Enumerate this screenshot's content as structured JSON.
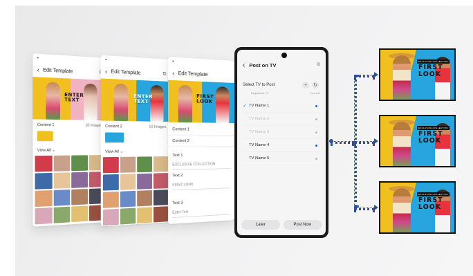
{
  "colors": {
    "accent": "#1c64d6",
    "connector": "#2c4fa0",
    "yellow": "#f2c01e",
    "blue": "#27a5de"
  },
  "screen1": {
    "header": {
      "title": "Edit Template"
    },
    "hero": {
      "text": "ENTER TEXT"
    },
    "content_row": {
      "label": "Content 1",
      "value": "10 Images"
    },
    "view_all": "View All ⌄"
  },
  "screen2": {
    "header": {
      "title": "Edit Template"
    },
    "hero": {
      "text": "ENTER TEXT"
    },
    "content_row": {
      "label": "Content 2",
      "value": "10 Images"
    },
    "view_all": "View All ⌄"
  },
  "screen3": {
    "header": {
      "title": "Edit Template"
    },
    "hero": {
      "text": "FIRST LOOK"
    },
    "rows": [
      "Content 1",
      "Content 2"
    ],
    "fields": [
      {
        "label": "Text 1",
        "value": "EXCLUSIVE COLLECTION"
      },
      {
        "label": "Text 2",
        "value": "FIRST LOOK"
      },
      {
        "label": "Text 3",
        "value": "Enter Text"
      }
    ]
  },
  "phone": {
    "header": {
      "title": "Post on TV"
    },
    "section_label": "Select TV to Post",
    "col_registered": "Registered TV",
    "col_connect": "Connect",
    "tvs": [
      {
        "name": "TV Name 1",
        "checked": true,
        "enabled": true,
        "connected": true
      },
      {
        "name": "TV Name 2",
        "checked": false,
        "enabled": false,
        "connected": false
      },
      {
        "name": "TV Name 3",
        "checked": false,
        "enabled": false,
        "connected": false
      },
      {
        "name": "TV Name 4",
        "checked": false,
        "enabled": true,
        "connected": true
      },
      {
        "name": "TV Name 5",
        "checked": false,
        "enabled": true,
        "connected": false
      }
    ],
    "buttons": {
      "later": "Later",
      "post_now": "Post Now"
    }
  },
  "tv_displays": [
    {
      "badge": "EXCLUSIVE COLLECTION",
      "headline": "FIRST LOOK"
    },
    {
      "badge": "EXCLUSIVE COLLECTION",
      "headline": "FIRST LOOK"
    },
    {
      "badge": "EXCLUSIVE COLLECTION",
      "headline": "FIRST LOOK"
    }
  ]
}
